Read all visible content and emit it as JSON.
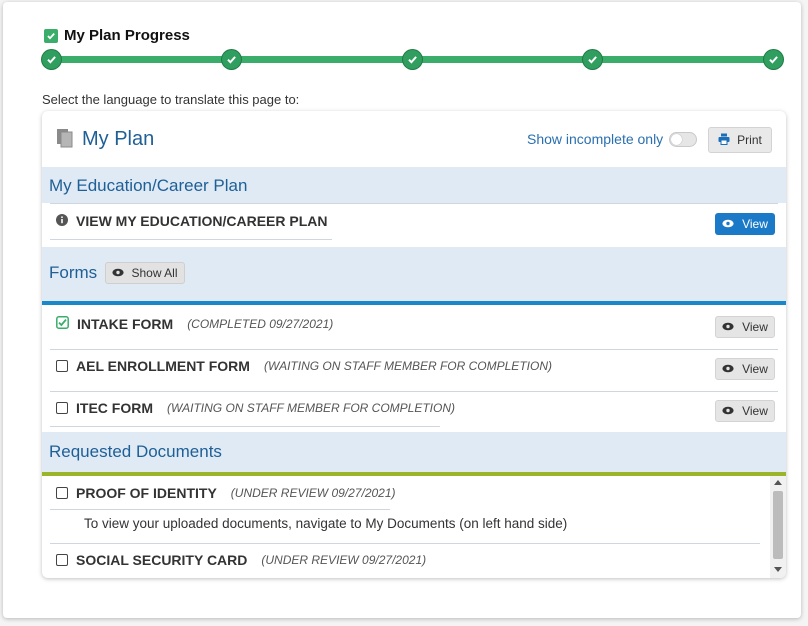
{
  "progress": {
    "title": "My Plan Progress",
    "steps_completed": 5,
    "steps_total": 5
  },
  "translate_label": "Select the language to translate this page to:",
  "panel": {
    "title": "My Plan",
    "show_incomplete_label": "Show incomplete only",
    "show_incomplete_on": false,
    "print_label": "Print"
  },
  "education": {
    "title": "My Education/Career Plan",
    "item_label": "VIEW MY EDUCATION/CAREER PLAN",
    "view_label": "View"
  },
  "forms": {
    "title": "Forms",
    "show_all_label": "Show All",
    "accent_color": "#1a87c9",
    "items": [
      {
        "label": "INTAKE FORM",
        "status": "(COMPLETED 09/27/2021)",
        "checked": true,
        "view_label": "View"
      },
      {
        "label": "AEL ENROLLMENT FORM",
        "status": "(WAITING ON STAFF MEMBER FOR COMPLETION)",
        "checked": false,
        "view_label": "View"
      },
      {
        "label": "ITEC FORM",
        "status": "(WAITING ON STAFF MEMBER FOR COMPLETION)",
        "checked": false,
        "view_label": "View"
      }
    ]
  },
  "documents": {
    "title": "Requested Documents",
    "accent_color": "#9bb52a",
    "items": [
      {
        "label": "PROOF OF IDENTITY",
        "status": "(UNDER REVIEW 09/27/2021)",
        "checked": false
      },
      {
        "label": "SOCIAL SECURITY CARD",
        "status": "(UNDER REVIEW 09/27/2021)",
        "checked": false
      }
    ],
    "note": "To view your uploaded documents, navigate to My Documents (on left hand side)"
  },
  "colors": {
    "green": "#3aad6a",
    "blue_text": "#1e5f96",
    "section_bg": "#dfeaf5",
    "primary_button": "#1a7ac7"
  }
}
